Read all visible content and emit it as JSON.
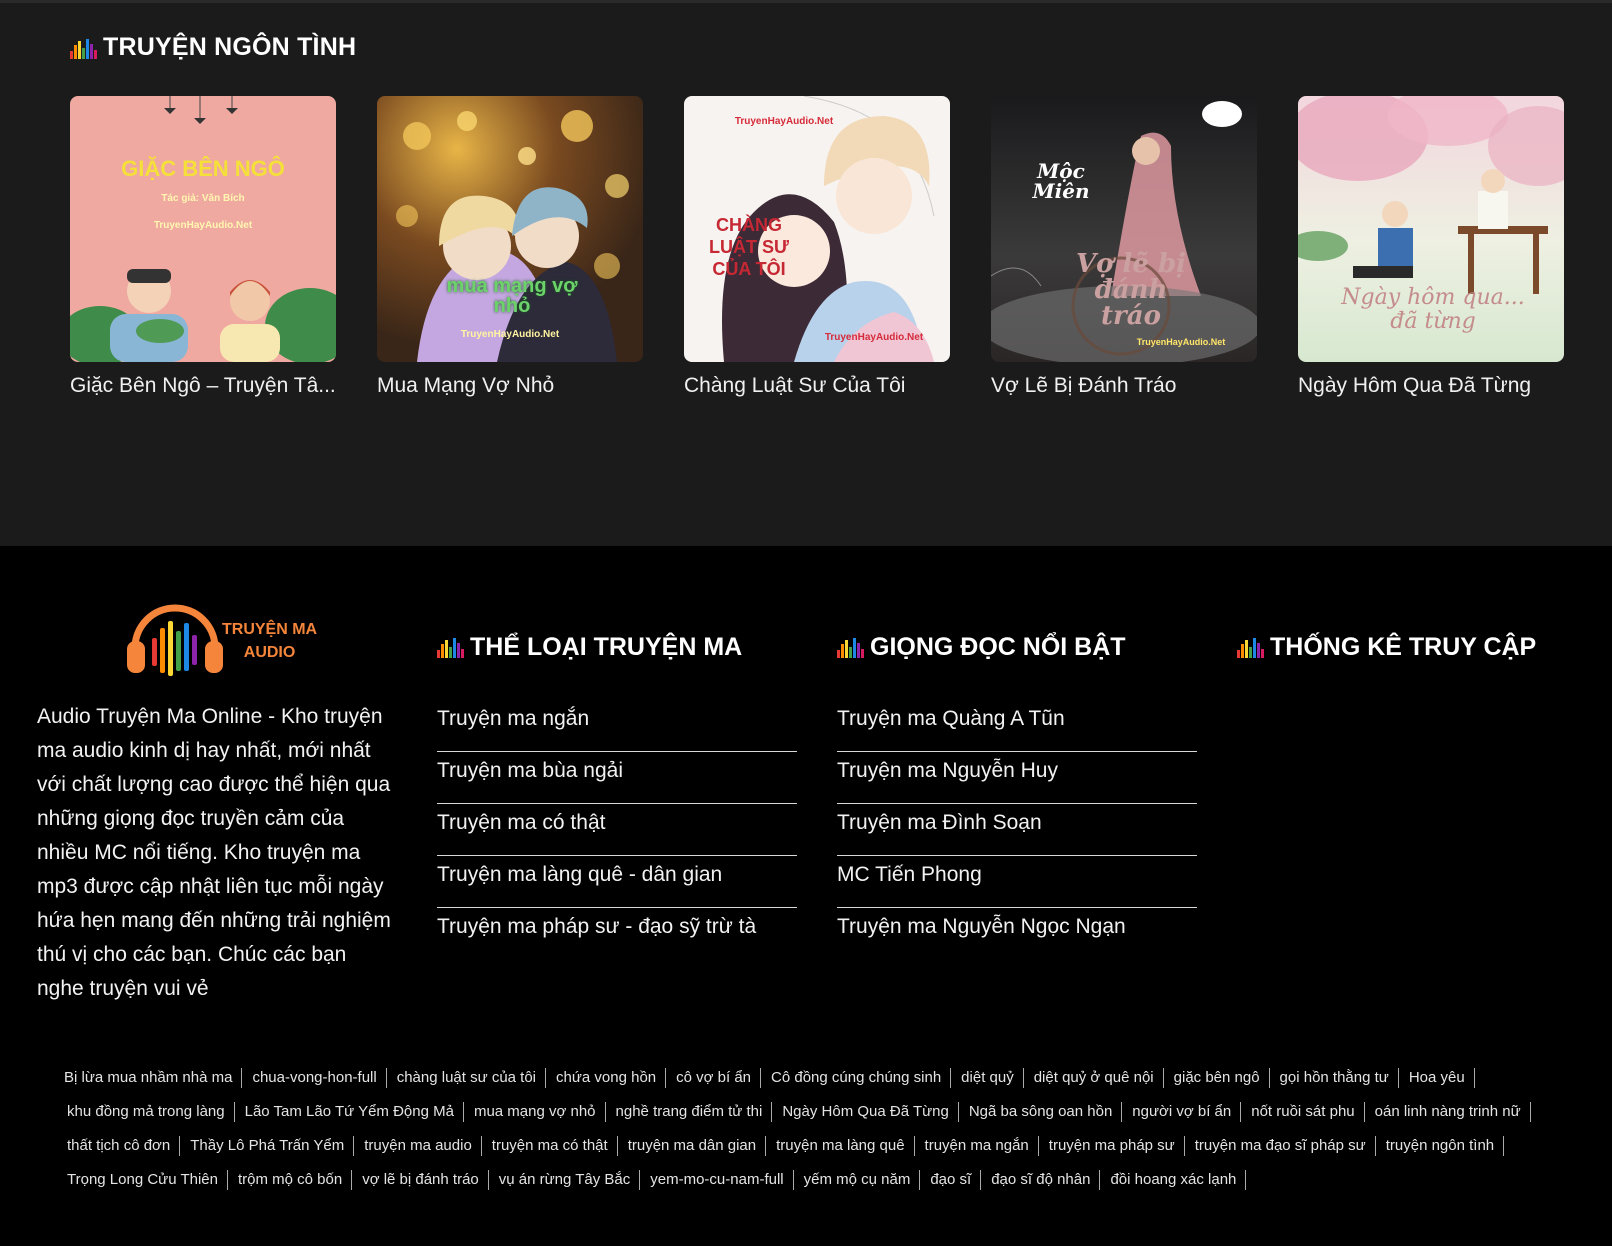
{
  "section": {
    "title": "TRUYỆN NGÔN TÌNH"
  },
  "stories": [
    {
      "title": "Giặc Bên Ngô – Truyện Tâ...",
      "cover_title": "GIẶC BÊN NGÔ",
      "cover_author": "Tác giả: Văn Bích",
      "cover_site": "TruyenHayAudio.Net"
    },
    {
      "title": "Mua Mạng Vợ Nhỏ",
      "cover_title": "mua mạng vợ nhỏ",
      "cover_site": "TruyenHayAudio.Net"
    },
    {
      "title": "Chàng Luật Sư Của Tôi",
      "cover_title": "CHÀNG LUẬT SƯ CỦA TÔI",
      "cover_site": "TruyenHayAudio.Net"
    },
    {
      "title": "Vợ Lẽ Bị Đánh Tráo",
      "cover_title": "Vợ lẽ bị đánh tráo",
      "cover_sub": "Mộc Miên",
      "cover_site": "TruyenHayAudio.Net"
    },
    {
      "title": "Ngày Hôm Qua Đã Từng",
      "cover_title": "Ngày hôm qua... đã từng"
    }
  ],
  "footer": {
    "logo_line1": "TRUYỆN MA",
    "logo_line2": "AUDIO",
    "about": "Audio Truyện Ma Online - Kho truyện ma audio kinh dị hay nhất, mới nhất với chất lượng cao được thể hiện qua những giọng đọc truyền cảm của nhiều MC nổi tiếng. Kho truyện ma mp3 được cập nhật liên tục mỗi ngày hứa hẹn mang đến những trải nghiệm thú vị cho các bạn. Chúc các bạn nghe truyện vui vẻ",
    "genres": {
      "title": "THỂ LOẠI TRUYỆN MA",
      "items": [
        "Truyện ma ngắn",
        "Truyện ma bùa ngải",
        "Truyện ma có thật",
        "Truyện ma làng quê - dân gian",
        "Truyện ma pháp sư - đạo sỹ trừ tà"
      ]
    },
    "voices": {
      "title": "GIỌNG ĐỌC NỔI BẬT",
      "items": [
        "Truyện ma Quàng A Tũn",
        "Truyện ma Nguyễn Huy",
        "Truyện ma Đình Soạn",
        "MC Tiến Phong",
        "Truyện ma Nguyễn Ngọc Ngạn"
      ]
    },
    "stats": {
      "title": "THỐNG KÊ TRUY CẬP"
    },
    "tags": [
      "Bị lừa mua nhầm nhà ma",
      "chua-vong-hon-full",
      "chàng luật sư của tôi",
      "chứa vong hồn",
      "cô vợ bí ẩn",
      "Cô đồng cúng chúng sinh",
      "diệt quỷ",
      "diệt quỷ ở quê nội",
      "giặc bên ngô",
      "gọi hồn thằng tư",
      "Hoa yêu",
      "khu đồng mả trong làng",
      "Lão Tam Lão Tứ Yểm Động Mả",
      "mua mạng vợ nhỏ",
      "nghề trang điểm tử thi",
      "Ngày Hôm Qua Đã Từng",
      "Ngã ba sông oan hồn",
      "người vợ bí ẩn",
      "nốt ruồi sát phu",
      "oán linh nàng trinh nữ",
      "thất tịch cô đơn",
      "Thầy Lô Phá Trấn Yểm",
      "truyện ma audio",
      "truyện ma có thật",
      "truyện ma dân gian",
      "truyện ma làng quê",
      "truyện ma ngắn",
      "truyện ma pháp sư",
      "truyện ma đạo sĩ pháp sư",
      "truyện ngôn tình",
      "Trọng Long Cửu Thiên",
      "trộm mộ cô bốn",
      "vợ lẽ bị đánh tráo",
      "vụ án rừng Tây Bắc",
      "yem-mo-cu-nam-full",
      "yếm mộ cụ năm",
      "đạo sĩ",
      "đạo sĩ độ nhân",
      "đồi hoang xác lạnh"
    ]
  },
  "colors": {
    "accent": "#f5853a",
    "bars": [
      "#e53935",
      "#fb8c00",
      "#fdd835",
      "#43a047",
      "#1e88e5",
      "#8e24aa",
      "#d81b60"
    ]
  }
}
